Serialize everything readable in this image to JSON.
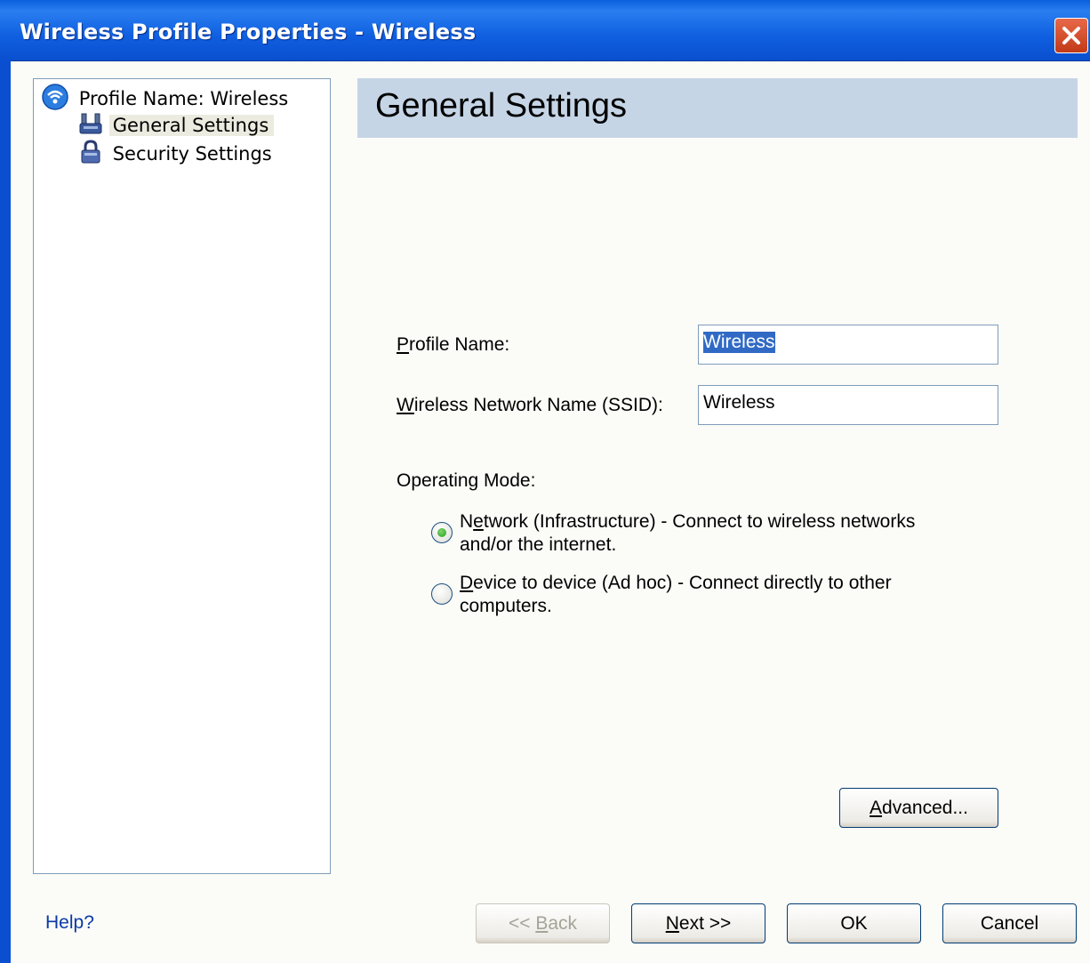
{
  "window": {
    "title": "Wireless Profile Properties - Wireless"
  },
  "tree": {
    "root": {
      "label": "Profile Name: Wireless",
      "icon": "wireless-network-icon"
    },
    "items": [
      {
        "label": "General Settings",
        "icon": "network-adapter-icon",
        "selected": true
      },
      {
        "label": "Security Settings",
        "icon": "padlock-icon",
        "selected": false
      }
    ]
  },
  "header": {
    "title": "General Settings"
  },
  "form": {
    "profile_name": {
      "label": "Profile Name:",
      "value": "Wireless"
    },
    "ssid": {
      "label": "Wireless Network Name (SSID):",
      "value": "Wireless"
    },
    "operating_mode": {
      "label": "Operating Mode:",
      "options": [
        {
          "line1": "Network (Infrastructure) - Connect to wireless networks",
          "line2": "and/or the internet.",
          "selected": true
        },
        {
          "line1": "Device to device (Ad hoc) - Connect directly to other",
          "line2": "computers.",
          "selected": false
        }
      ]
    }
  },
  "buttons": {
    "advanced": "Advanced...",
    "back": "<< Back",
    "next": "Next >>",
    "ok": "OK",
    "cancel": "Cancel"
  },
  "help": "Help?",
  "colors": {
    "titlebar": "#0a5fdd",
    "header_band": "#c5d5e6",
    "selection": "#316ac5",
    "link": "#0b3aa6"
  }
}
